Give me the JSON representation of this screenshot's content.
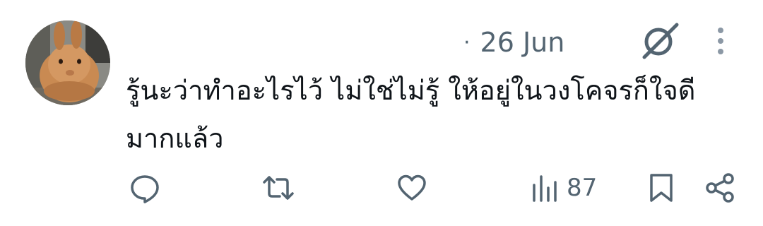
{
  "tweet": {
    "date_separator": "·",
    "date": "26 Jun",
    "text": "รู้นะว่าทำอะไรไว้ ไม่ใช่ไม่รู้ ให้อยู่ในวงโคจรก็ใจดีมากแล้ว"
  },
  "actions": {
    "views_count": "87"
  },
  "icons": {
    "reply": "reply-icon",
    "retweet": "retweet-icon",
    "like": "heart-icon",
    "views": "views-icon",
    "bookmark": "bookmark-icon",
    "share": "share-icon",
    "grok": "grok-icon",
    "more": "more-options-icon"
  },
  "colors": {
    "text": "#0f1419",
    "secondary": "#536471",
    "background": "#ffffff"
  }
}
